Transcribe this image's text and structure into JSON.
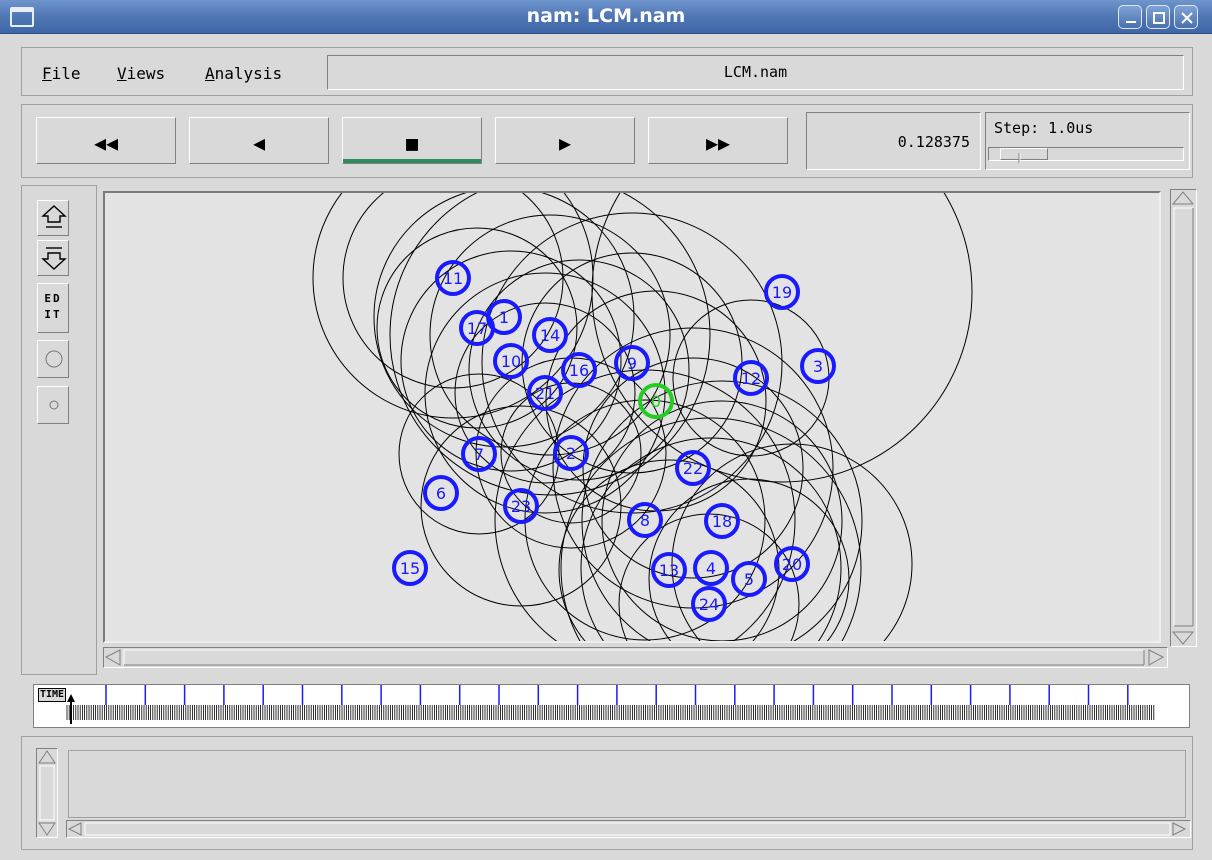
{
  "window": {
    "title": "nam: LCM.nam",
    "buttons": [
      "minimize-icon",
      "maximize-icon",
      "close-icon"
    ]
  },
  "menu": {
    "items": [
      {
        "label": "File",
        "mnemonic": "F"
      },
      {
        "label": "Views",
        "mnemonic": "V"
      },
      {
        "label": "Analysis",
        "mnemonic": "A"
      }
    ],
    "filename": "LCM.nam"
  },
  "controls": {
    "buttons": [
      {
        "name": "rewind-button",
        "glyph": "◀◀"
      },
      {
        "name": "step-back-button",
        "glyph": "◀"
      },
      {
        "name": "stop-button",
        "glyph": "■"
      },
      {
        "name": "play-button",
        "glyph": "▶"
      },
      {
        "name": "fast-forward-button",
        "glyph": "▶▶"
      }
    ],
    "time": "0.128375",
    "step_label": "Step: 1.0us"
  },
  "tools": {
    "edit_label_top": "ED",
    "edit_label_bottom": "IT"
  },
  "timeline": {
    "label": "TIME"
  },
  "network": {
    "nodes": [
      {
        "id": "11",
        "color": "#1a1aff"
      },
      {
        "id": "19",
        "color": "#1a1aff"
      },
      {
        "id": "17",
        "color": "#1a1aff"
      },
      {
        "id": "1",
        "color": "#1a1aff"
      },
      {
        "id": "14",
        "color": "#1a1aff"
      },
      {
        "id": "10",
        "color": "#1a1aff"
      },
      {
        "id": "16",
        "color": "#1a1aff"
      },
      {
        "id": "9",
        "color": "#1a1aff"
      },
      {
        "id": "12",
        "color": "#1a1aff"
      },
      {
        "id": "3",
        "color": "#1a1aff"
      },
      {
        "id": "21",
        "color": "#1a1aff"
      },
      {
        "id": "0",
        "color": "#22cc22"
      },
      {
        "id": "7",
        "color": "#1a1aff"
      },
      {
        "id": "2",
        "color": "#1a1aff"
      },
      {
        "id": "6",
        "color": "#1a1aff"
      },
      {
        "id": "23",
        "color": "#1a1aff"
      },
      {
        "id": "22",
        "color": "#1a1aff"
      },
      {
        "id": "8",
        "color": "#1a1aff"
      },
      {
        "id": "18",
        "color": "#1a1aff"
      },
      {
        "id": "15",
        "color": "#1a1aff"
      },
      {
        "id": "13",
        "color": "#1a1aff"
      },
      {
        "id": "4",
        "color": "#1a1aff"
      },
      {
        "id": "20",
        "color": "#1a1aff"
      },
      {
        "id": "5",
        "color": "#1a1aff"
      },
      {
        "id": "24",
        "color": "#1a1aff"
      }
    ]
  }
}
